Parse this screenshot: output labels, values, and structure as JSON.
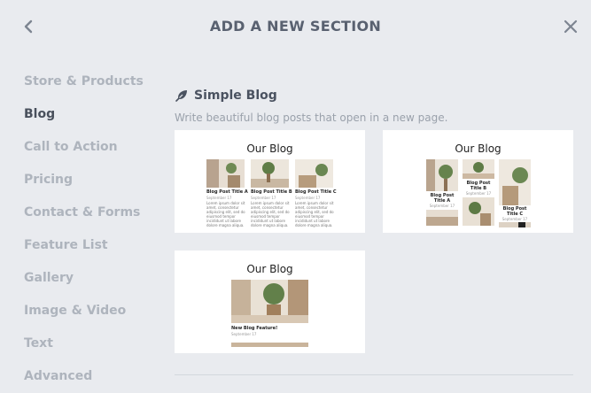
{
  "header": {
    "title": "ADD A NEW SECTION"
  },
  "sidebar": {
    "items": [
      {
        "label": "Store & Products"
      },
      {
        "label": "Blog"
      },
      {
        "label": "Call to Action"
      },
      {
        "label": "Pricing"
      },
      {
        "label": "Contact & Forms"
      },
      {
        "label": "Feature List"
      },
      {
        "label": "Gallery"
      },
      {
        "label": "Image & Video"
      },
      {
        "label": "Text"
      },
      {
        "label": "Advanced"
      }
    ],
    "active": "Blog"
  },
  "section": {
    "icon": "feather-icon",
    "name": "Simple Blog",
    "description": "Write beautiful blog posts that open in a new page."
  },
  "cards": [
    {
      "title": "Our Blog",
      "posts": [
        {
          "title": "Blog Post Title A",
          "date": "September 17",
          "text": "Lorem ipsum dolor sit amet, consectetur adipiscing elit, sed do eiusmod tempor incididunt ut labore dolore magna aliqua."
        },
        {
          "title": "Blog Post Title B",
          "date": "September 17",
          "text": "Lorem ipsum dolor sit amet, consectetur adipiscing elit, sed do eiusmod tempor incididunt ut labore dolore magna aliqua."
        },
        {
          "title": "Blog Post Title C",
          "date": "September 17",
          "text": "Lorem ipsum dolor sit amet, consectetur adipiscing elit, sed do eiusmod tempor incididunt ut labore dolore magna aliqua."
        }
      ]
    },
    {
      "title": "Our Blog",
      "posts": [
        {
          "title": "Blog Post Title A",
          "date": "September 17"
        },
        {
          "title": "Blog Post Title B",
          "date": "September 17"
        },
        {
          "title": "Blog Post Title C",
          "date": "September 17"
        }
      ]
    },
    {
      "title": "Our Blog",
      "posts": [
        {
          "title": "New Blog Feature!",
          "date": "September 17"
        }
      ]
    }
  ],
  "colors": {
    "background": "#e9ebef",
    "card": "#ffffff",
    "active": "#49505c",
    "inactive": "#aeb4bd"
  }
}
